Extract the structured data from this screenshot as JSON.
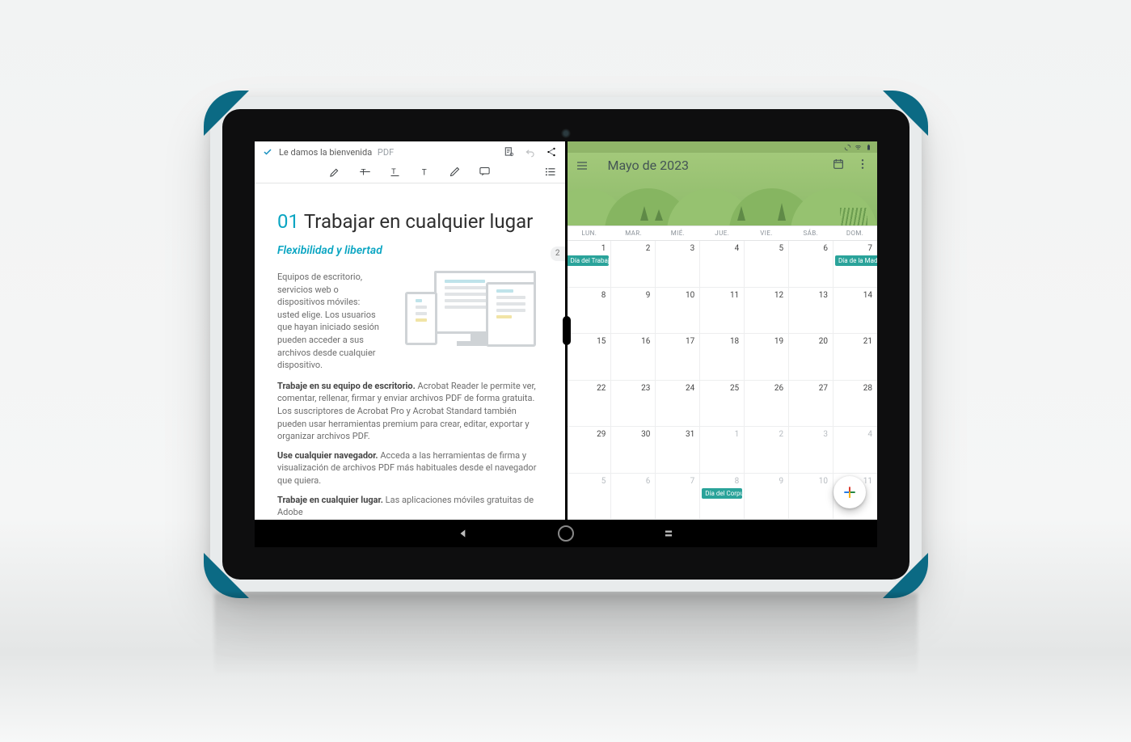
{
  "pdf": {
    "title": "Le damos la bienvenida",
    "type": "PDF",
    "page_badge": "2",
    "h1_num": "01",
    "h1_text": "Trabajar en cualquier lugar",
    "h2": "Flexibilidad y libertad",
    "intro": "Equipos de escritorio, servicios web o dispositivos móviles: usted elige. Los usuarios que hayan iniciado sesión pueden acceder a sus archivos desde cualquier dispositivo.",
    "p1_bold": "Trabaje en su equipo de escritorio.",
    "p1": " Acrobat Reader le permite ver, comentar, rellenar, firmar y enviar archivos PDF de forma gratuita. Los suscriptores de Acrobat Pro y Acrobat Standard también pueden usar herramientas premium para crear, editar, exportar y organizar archivos PDF.",
    "p2_bold": "Use cualquier navegador.",
    "p2": " Acceda a las herramientas de firma y visualización de archivos PDF más habituales desde el navegador que quiera.",
    "p3_bold": "Trabaje en cualquier lugar.",
    "p3": " Las aplicaciones móviles gratuitas de Adobe"
  },
  "calendar": {
    "title": "Mayo de 2023",
    "daynames": [
      "LUN.",
      "MAR.",
      "MIÉ.",
      "JUE.",
      "VIE.",
      "SÁB.",
      "DOM."
    ],
    "weeks": [
      {
        "days": [
          {
            "n": "1",
            "ev": "Día del Trabajo",
            "left": true
          },
          {
            "n": "2"
          },
          {
            "n": "3"
          },
          {
            "n": "4"
          },
          {
            "n": "5"
          },
          {
            "n": "6"
          },
          {
            "n": "7",
            "ev": "Día de la Madre",
            "right": true
          }
        ]
      },
      {
        "days": [
          {
            "n": "8"
          },
          {
            "n": "9"
          },
          {
            "n": "10"
          },
          {
            "n": "11"
          },
          {
            "n": "12"
          },
          {
            "n": "13"
          },
          {
            "n": "14"
          }
        ]
      },
      {
        "days": [
          {
            "n": "15"
          },
          {
            "n": "16"
          },
          {
            "n": "17"
          },
          {
            "n": "18"
          },
          {
            "n": "19"
          },
          {
            "n": "20"
          },
          {
            "n": "21"
          }
        ]
      },
      {
        "days": [
          {
            "n": "22"
          },
          {
            "n": "23"
          },
          {
            "n": "24"
          },
          {
            "n": "25"
          },
          {
            "n": "26"
          },
          {
            "n": "27"
          },
          {
            "n": "28"
          }
        ]
      },
      {
        "days": [
          {
            "n": "29"
          },
          {
            "n": "30"
          },
          {
            "n": "31"
          },
          {
            "n": "1",
            "out": true
          },
          {
            "n": "2",
            "out": true
          },
          {
            "n": "3",
            "out": true
          },
          {
            "n": "4",
            "out": true
          }
        ]
      },
      {
        "days": [
          {
            "n": "5",
            "out": true
          },
          {
            "n": "6",
            "out": true
          },
          {
            "n": "7",
            "out": true
          },
          {
            "n": "8",
            "out": true,
            "ev": "Día del Corpus"
          },
          {
            "n": "9",
            "out": true
          },
          {
            "n": "10",
            "out": true
          },
          {
            "n": "11",
            "out": true
          }
        ]
      }
    ]
  }
}
